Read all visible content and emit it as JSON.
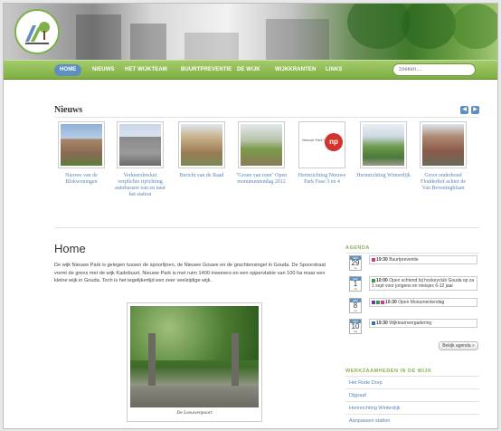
{
  "nav": {
    "items": [
      "HOME",
      "NIEUWS",
      "HET WIJKTEAM",
      "BUURTPREVENTIE",
      "DE WIJK",
      "WIJKKRANTEN",
      "LINKS"
    ],
    "search_placeholder": "zoeken...."
  },
  "nieuws": {
    "title": "Nieuws",
    "items": [
      {
        "caption": "Nieuws van de Blokwoningen"
      },
      {
        "caption": "Verkeersbesluit verplichte rijrichting autobussen van en naar het station"
      },
      {
        "caption": "Bericht van de Raad"
      },
      {
        "caption": "\"Groen van toen\" Open monumentendag 2012"
      },
      {
        "caption": "Herinrichting Nieuwe Park Fase 3 en 4"
      },
      {
        "caption": "Herinrichting Winterdijk"
      },
      {
        "caption": "Groot onderhoud Flodderhof achter de Van Beveninghlaan"
      }
    ],
    "thumb_logo_text": "Nieuwe Park Gouda",
    "thumb_logo_mark": "np"
  },
  "main": {
    "title": "Home",
    "intro": "De wijk Nieuwe Park is gelegen tussen de spoorlijnen, de Nieuwe Gouwe en de grachtensingel in Gouda. De Spoorstraat vormt de grens met de wijk Kadebuurt. Nieuwe Park is met ruim 1400 inwoners en een oppervlakte van 100 ha maar een kleine wijk in Gouda. Toch is het tegelijkertijd een zeer veelzijdige wijk.",
    "photo_caption": "De Leeuwenpoort"
  },
  "agenda": {
    "heading": "AGENDA",
    "events": [
      {
        "mon": "SEP",
        "day": "29",
        "wd": "za",
        "time": "19:30",
        "text": "Buurtpreventie",
        "color": "#d03a8a"
      },
      {
        "mon": "SEP",
        "day": "1",
        "wd": "za",
        "time": "10:00",
        "text": "Open schtend bij hockeyclub Gouda op za 1 sept voor jongens en meisjes 6-12 jaar",
        "color": "#3a9a4a"
      },
      {
        "mon": "SEP",
        "day": "8",
        "wd": "za",
        "time": "10:30",
        "text": "Open Monumentendag",
        "color": "#6b3aa8"
      },
      {
        "mon": "SEP",
        "day": "10",
        "wd": "ma",
        "time": "19:30",
        "text": "Wijkteamvergadering",
        "color": "#3a6fb0"
      }
    ],
    "button": "Bekijk agenda »"
  },
  "werkzaam": {
    "heading": "WERKZAAMHEDEN IN DE WIJK",
    "links": [
      "Het Rode Dorp",
      "Dijgraaf",
      "Herinrichting Winterdijk",
      "Aanpassen station"
    ]
  },
  "colors": {
    "accent": "#5e8fbf",
    "nav_green": "#8ab252",
    "link": "#5a86b6"
  }
}
